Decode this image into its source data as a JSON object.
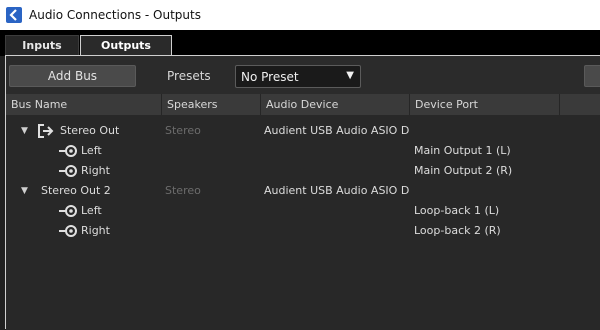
{
  "window": {
    "title": "Audio Connections - Outputs"
  },
  "tabs": [
    {
      "label": "Inputs"
    },
    {
      "label": "Outputs"
    }
  ],
  "toolbar": {
    "add_bus_label": "Add Bus",
    "presets_label": "Presets",
    "preset_value": "No Preset"
  },
  "table": {
    "columns": [
      "Bus Name",
      "Speakers",
      "Audio Device",
      "Device Port"
    ],
    "rows": [
      {
        "name": "Stereo Out",
        "speakers": "Stereo",
        "device": "Audient USB Audio ASIO Dr",
        "port": "",
        "level": 0,
        "icon": "output-arrow-icon"
      },
      {
        "name": "Left",
        "speakers": "",
        "device": "",
        "port": "Main Output 1 (L)",
        "level": 1,
        "icon": "channel-port-icon"
      },
      {
        "name": "Right",
        "speakers": "",
        "device": "",
        "port": "Main Output 2 (R)",
        "level": 1,
        "icon": "channel-port-icon"
      },
      {
        "name": "Stereo Out 2",
        "speakers": "Stereo",
        "device": "Audient USB Audio ASIO Dr",
        "port": "",
        "level": 0,
        "icon": ""
      },
      {
        "name": "Left",
        "speakers": "",
        "device": "",
        "port": "Loop-back 1 (L)",
        "level": 1,
        "icon": "channel-port-icon"
      },
      {
        "name": "Right",
        "speakers": "",
        "device": "",
        "port": "Loop-back 2 (R)",
        "level": 1,
        "icon": "channel-port-icon"
      }
    ]
  },
  "colors": {
    "titlebar_bg": "#ffffff",
    "panel_bg": "#2b2b2b",
    "header_bg": "#3a3a3a",
    "app_icon": "#2a64c4"
  }
}
